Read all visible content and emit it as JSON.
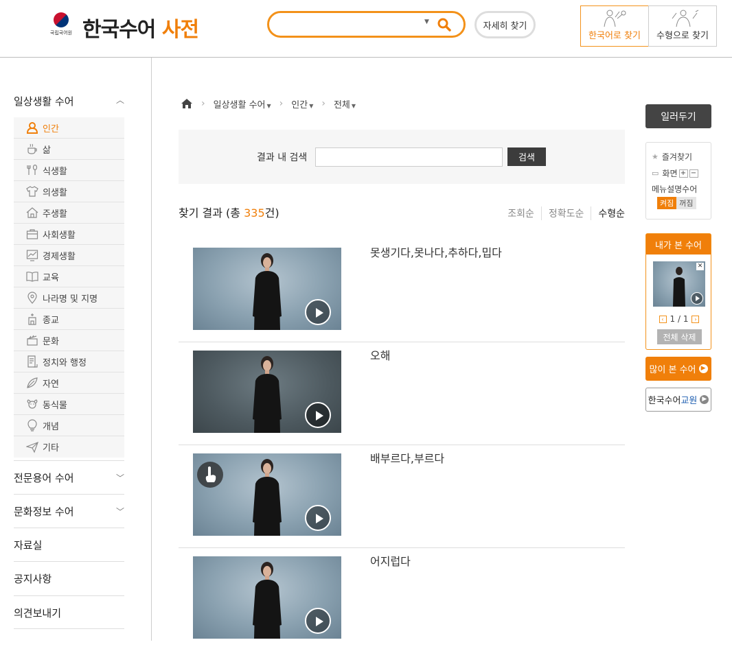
{
  "header": {
    "org_name": "국립국어원",
    "title_main": "한국수어",
    "title_accent": "사전",
    "search": {
      "value": "",
      "placeholder": ""
    },
    "detail_search_label": "자세히 찾기",
    "mode_korean_label": "한국어로 찾기",
    "mode_shape_label": "수형으로 찾기"
  },
  "sidebar": {
    "section_title": "일상생활 수어",
    "items": [
      {
        "label": "인간",
        "icon": "person-icon",
        "active": true
      },
      {
        "label": "삶",
        "icon": "cup-icon"
      },
      {
        "label": "식생활",
        "icon": "fork-spoon-icon"
      },
      {
        "label": "의생활",
        "icon": "shirt-icon"
      },
      {
        "label": "주생활",
        "icon": "house-icon"
      },
      {
        "label": "사회생활",
        "icon": "briefcase-icon"
      },
      {
        "label": "경제생활",
        "icon": "chart-icon"
      },
      {
        "label": "교육",
        "icon": "book-icon"
      },
      {
        "label": "나라명 및 지명",
        "icon": "map-pin-icon"
      },
      {
        "label": "종교",
        "icon": "church-icon"
      },
      {
        "label": "문화",
        "icon": "clapper-icon"
      },
      {
        "label": "정치와 행정",
        "icon": "document-icon"
      },
      {
        "label": "자연",
        "icon": "leaf-icon"
      },
      {
        "label": "동식물",
        "icon": "dog-icon"
      },
      {
        "label": "개념",
        "icon": "lightbulb-icon"
      },
      {
        "label": "기타",
        "icon": "paper-plane-icon"
      }
    ],
    "links": [
      {
        "label": "전문용어 수어",
        "expandable": true
      },
      {
        "label": "문화정보 수어",
        "expandable": true
      },
      {
        "label": "자료실",
        "expandable": false
      },
      {
        "label": "공지사항",
        "expandable": false
      },
      {
        "label": "의견보내기",
        "expandable": false
      }
    ]
  },
  "breadcrumb": [
    "일상생활 수어",
    "인간",
    "전체"
  ],
  "inner_search": {
    "label": "결과 내 검색",
    "value": "",
    "button": "검색"
  },
  "results_header": {
    "prefix": "찾기 결과 (총 ",
    "count": "335",
    "suffix": "건)"
  },
  "sort_options": [
    "조회순",
    "정확도순",
    "수형순"
  ],
  "sort_selected": "수형순",
  "results": [
    {
      "word": "못생기다,못나다,추하다,밉다",
      "dark": false,
      "finger_badge": false
    },
    {
      "word": "오해",
      "dark": true,
      "finger_badge": false
    },
    {
      "word": "배부르다,부르다",
      "dark": false,
      "finger_badge": true
    },
    {
      "word": "어지럽다",
      "dark": false,
      "finger_badge": false
    }
  ],
  "rail": {
    "guide_label": "일러두기",
    "favorites_label": "즐겨찾기",
    "screen_label": "화면",
    "zoom_in": "+",
    "zoom_out": "−",
    "menu_sign_label": "메뉴설명수어",
    "on_label": "켜짐",
    "off_label": "꺼짐",
    "recent_title": "내가 본 수어",
    "recent_page": "1 / 1",
    "delete_all": "전체 삭제",
    "popular_label": "많이 본 수어",
    "teacher_prefix": "한국수어",
    "teacher_accent": "교원"
  },
  "colors": {
    "accent": "#f07f0a",
    "dark_button": "#3c3c3c",
    "teacher_blue": "#1c5db0"
  }
}
